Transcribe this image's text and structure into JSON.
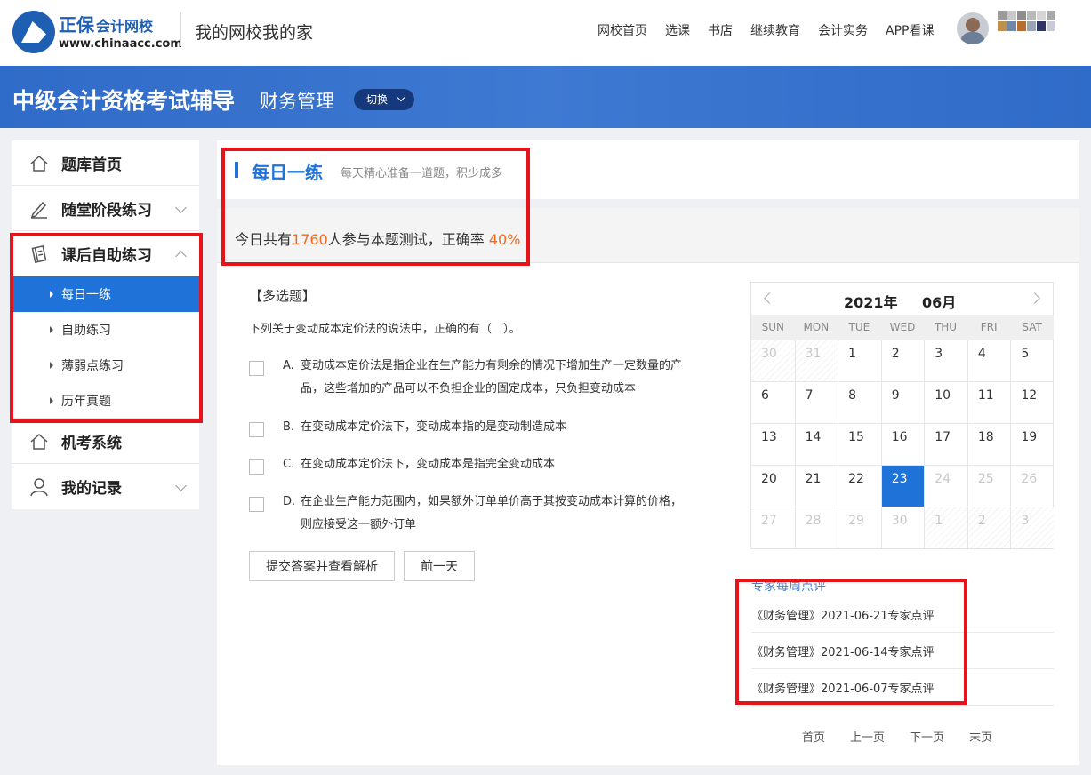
{
  "header": {
    "brand_name": "正保",
    "brand_sub": "会计网校",
    "brand_url": "www.chinaacc.com",
    "slogan": "我的网校我的家",
    "nav": [
      "网校首页",
      "选课",
      "书店",
      "继续教育",
      "会计实务",
      "APP看课"
    ]
  },
  "banner": {
    "title": "中级会计资格考试辅导",
    "subject": "财务管理",
    "switch_label": "切换"
  },
  "sidebar": {
    "items": [
      {
        "label": "题库首页",
        "icon": "home-icon"
      },
      {
        "label": "随堂阶段练习",
        "icon": "pen-icon"
      },
      {
        "label": "课后自助练习",
        "icon": "notebook-icon"
      },
      {
        "label": "机考系统",
        "icon": "home-icon"
      },
      {
        "label": "我的记录",
        "icon": "user-icon"
      }
    ],
    "sub_items": [
      "每日一练",
      "自助练习",
      "薄弱点练习",
      "历年真题"
    ]
  },
  "daily": {
    "title": "每日一练",
    "subtitle": "每天精心准备一道题，积少成多",
    "stats_prefix": "今日共有",
    "participants": "1760",
    "stats_mid": "人参与本题测试，正确率",
    "accuracy": "40%"
  },
  "question": {
    "type": "【多选题】",
    "stem": "下列关于变动成本定价法的说法中，正确的有（　）。",
    "options": [
      {
        "letter": "A.",
        "text": "变动成本定价法是指企业在生产能力有剩余的情况下增加生产一定数量的产品，这些增加的产品可以不负担企业的固定成本，只负担变动成本"
      },
      {
        "letter": "B.",
        "text": "在变动成本定价法下，变动成本指的是变动制造成本"
      },
      {
        "letter": "C.",
        "text": "在变动成本定价法下，变动成本是指完全变动成本"
      },
      {
        "letter": "D.",
        "text": "在企业生产能力范围内，如果额外订单单价高于其按变动成本计算的价格，则应接受这一额外订单"
      }
    ],
    "submit_label": "提交答案并查看解析",
    "prev_day_label": "前一天"
  },
  "calendar": {
    "year": "2021年",
    "month": "06月",
    "weekdays": [
      "SUN",
      "MON",
      "TUE",
      "WED",
      "THU",
      "FRI",
      "SAT"
    ],
    "today": "23",
    "days": [
      "30",
      "31",
      "1",
      "2",
      "3",
      "4",
      "5",
      "6",
      "7",
      "8",
      "9",
      "10",
      "11",
      "12",
      "13",
      "14",
      "15",
      "16",
      "17",
      "18",
      "19",
      "20",
      "21",
      "22",
      "23",
      "24",
      "25",
      "26",
      "27",
      "28",
      "29",
      "30",
      "1",
      "2",
      "3"
    ]
  },
  "reviews": {
    "title": "专家每周点评",
    "items": [
      "《财务管理》2021-06-21专家点评",
      "《财务管理》2021-06-14专家点评",
      "《财务管理》2021-06-07专家点评"
    ]
  },
  "pager": [
    "首页",
    "上一页",
    "下一页",
    "末页"
  ],
  "colors": {
    "brand_blue": "#1f72d8",
    "banner_blue": "#3570c9",
    "highlight_orange": "#f26a21",
    "annotation_red": "#e5141b"
  }
}
